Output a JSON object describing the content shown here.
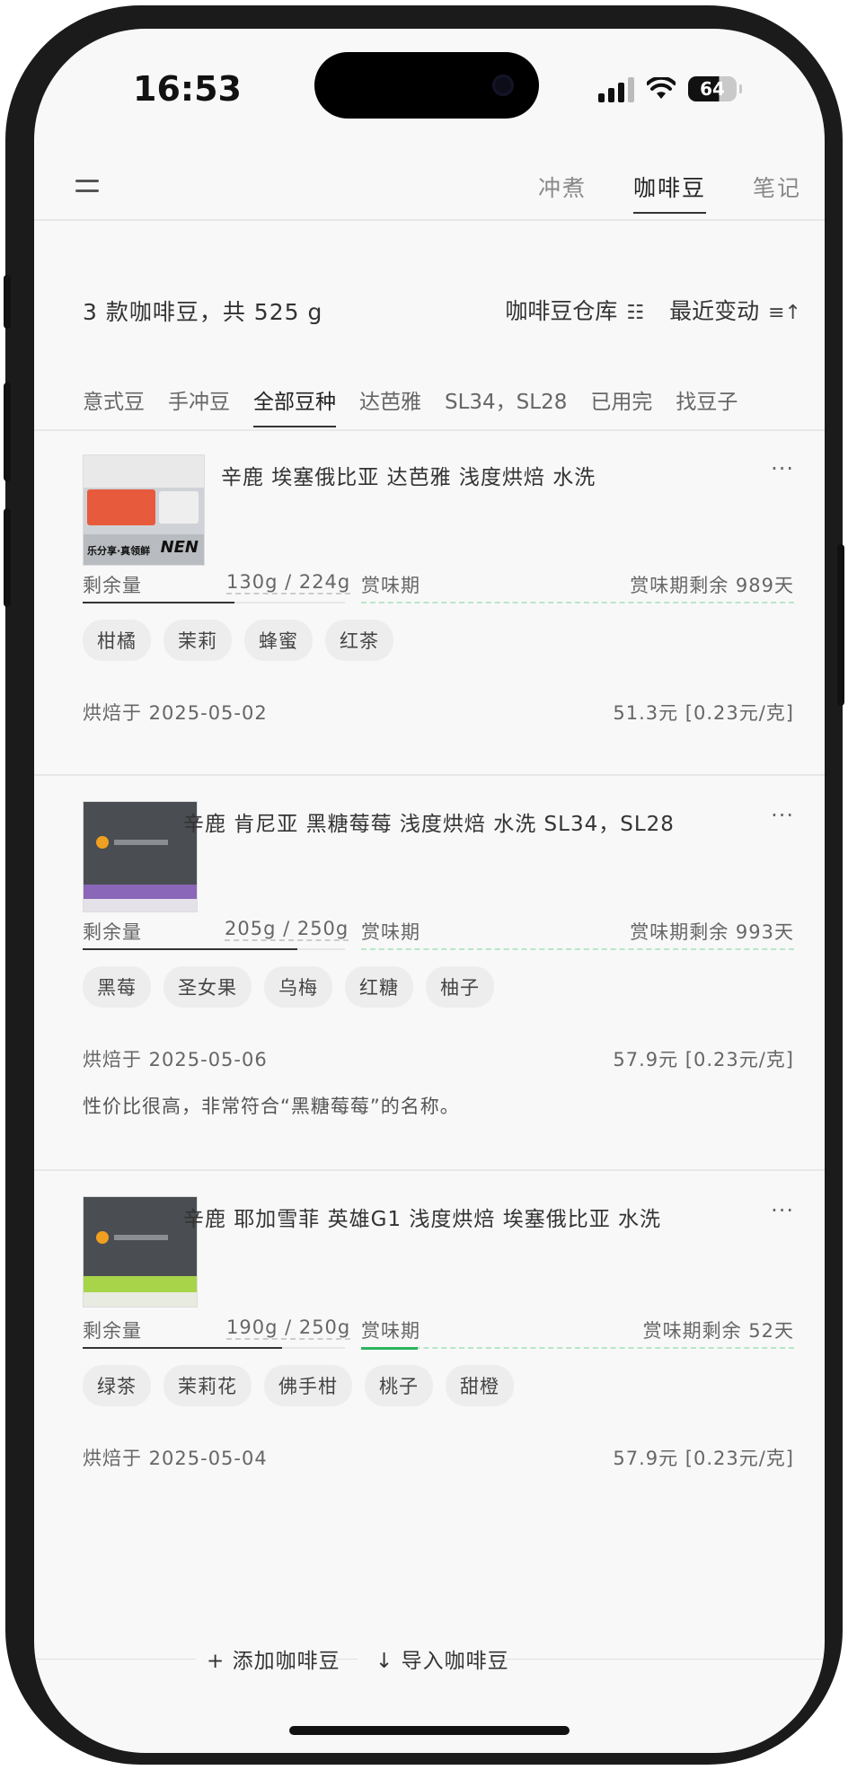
{
  "status_bar": {
    "time": "16:53",
    "battery": "64"
  },
  "nav": {
    "tabs": [
      {
        "label": "冲煮",
        "active": false
      },
      {
        "label": "咖啡豆",
        "active": true
      },
      {
        "label": "笔记",
        "active": false
      }
    ]
  },
  "summary": {
    "text": "3 款咖啡豆，共 525 g",
    "warehouse_label": "咖啡豆仓库",
    "warehouse_icon": "☷",
    "sort_label": "最近变动",
    "sort_icon": "≡↑"
  },
  "filters": [
    {
      "label": "意式豆",
      "active": false
    },
    {
      "label": "手冲豆",
      "active": false
    },
    {
      "label": "全部豆种",
      "active": true
    },
    {
      "label": "达芭雅",
      "active": false
    },
    {
      "label": "SL34，SL28",
      "active": false
    },
    {
      "label": "已用完",
      "active": false
    },
    {
      "label": "找豆子",
      "active": false
    }
  ],
  "beans": [
    {
      "name": "辛鹿 埃塞俄比亚 达芭雅 浅度烘焙 水洗",
      "more": "···",
      "remaining_label": "剩余量",
      "remaining_value": "130g / 224g",
      "remaining_fraction": 0.58,
      "freshness_label": "赏味期",
      "freshness_value": "赏味期剩余 989天",
      "freshness_fraction": 0.0,
      "tags": [
        "柑橘",
        "茉莉",
        "蜂蜜",
        "红茶"
      ],
      "roast_date": "烘焙于 2025-05-02",
      "price": "51.3元 [0.23元/克]",
      "note": "",
      "thumb_style": "light",
      "thumb_text": "乐分享·真领鲜",
      "thumb_brand": "NEN"
    },
    {
      "name": "辛鹿 肯尼亚 黑糖莓莓 浅度烘焙 水洗 SL34，SL28",
      "more": "···",
      "remaining_label": "剩余量",
      "remaining_value": "205g / 250g",
      "remaining_fraction": 0.82,
      "freshness_label": "赏味期",
      "freshness_value": "赏味期剩余 993天",
      "freshness_fraction": 0.0,
      "tags": [
        "黑莓",
        "圣女果",
        "乌梅",
        "红糖",
        "柚子"
      ],
      "roast_date": "烘焙于 2025-05-06",
      "price": "57.9元 [0.23元/克]",
      "note": "性价比很高，非常符合“黑糖莓莓”的名称。",
      "thumb_style": "dark-purple",
      "thumb_text": "",
      "thumb_brand": ""
    },
    {
      "name": "辛鹿 耶加雪菲 英雄G1 浅度烘焙 埃塞俄比亚 水洗",
      "more": "···",
      "remaining_label": "剩余量",
      "remaining_value": "190g / 250g",
      "remaining_fraction": 0.76,
      "freshness_label": "赏味期",
      "freshness_value": "赏味期剩余 52天",
      "freshness_fraction": 0.13,
      "tags": [
        "绿茶",
        "茉莉花",
        "佛手柑",
        "桃子",
        "甜橙"
      ],
      "roast_date": "烘焙于 2025-05-04",
      "price": "57.9元 [0.23元/克]",
      "note": "",
      "thumb_style": "dark-green",
      "thumb_text": "",
      "thumb_brand": ""
    }
  ],
  "actions": {
    "add": "+ 添加咖啡豆",
    "import": "↓ 导入咖啡豆"
  },
  "colors": {
    "freshness_green": "#2db35d",
    "background": "#f8f8f8"
  }
}
